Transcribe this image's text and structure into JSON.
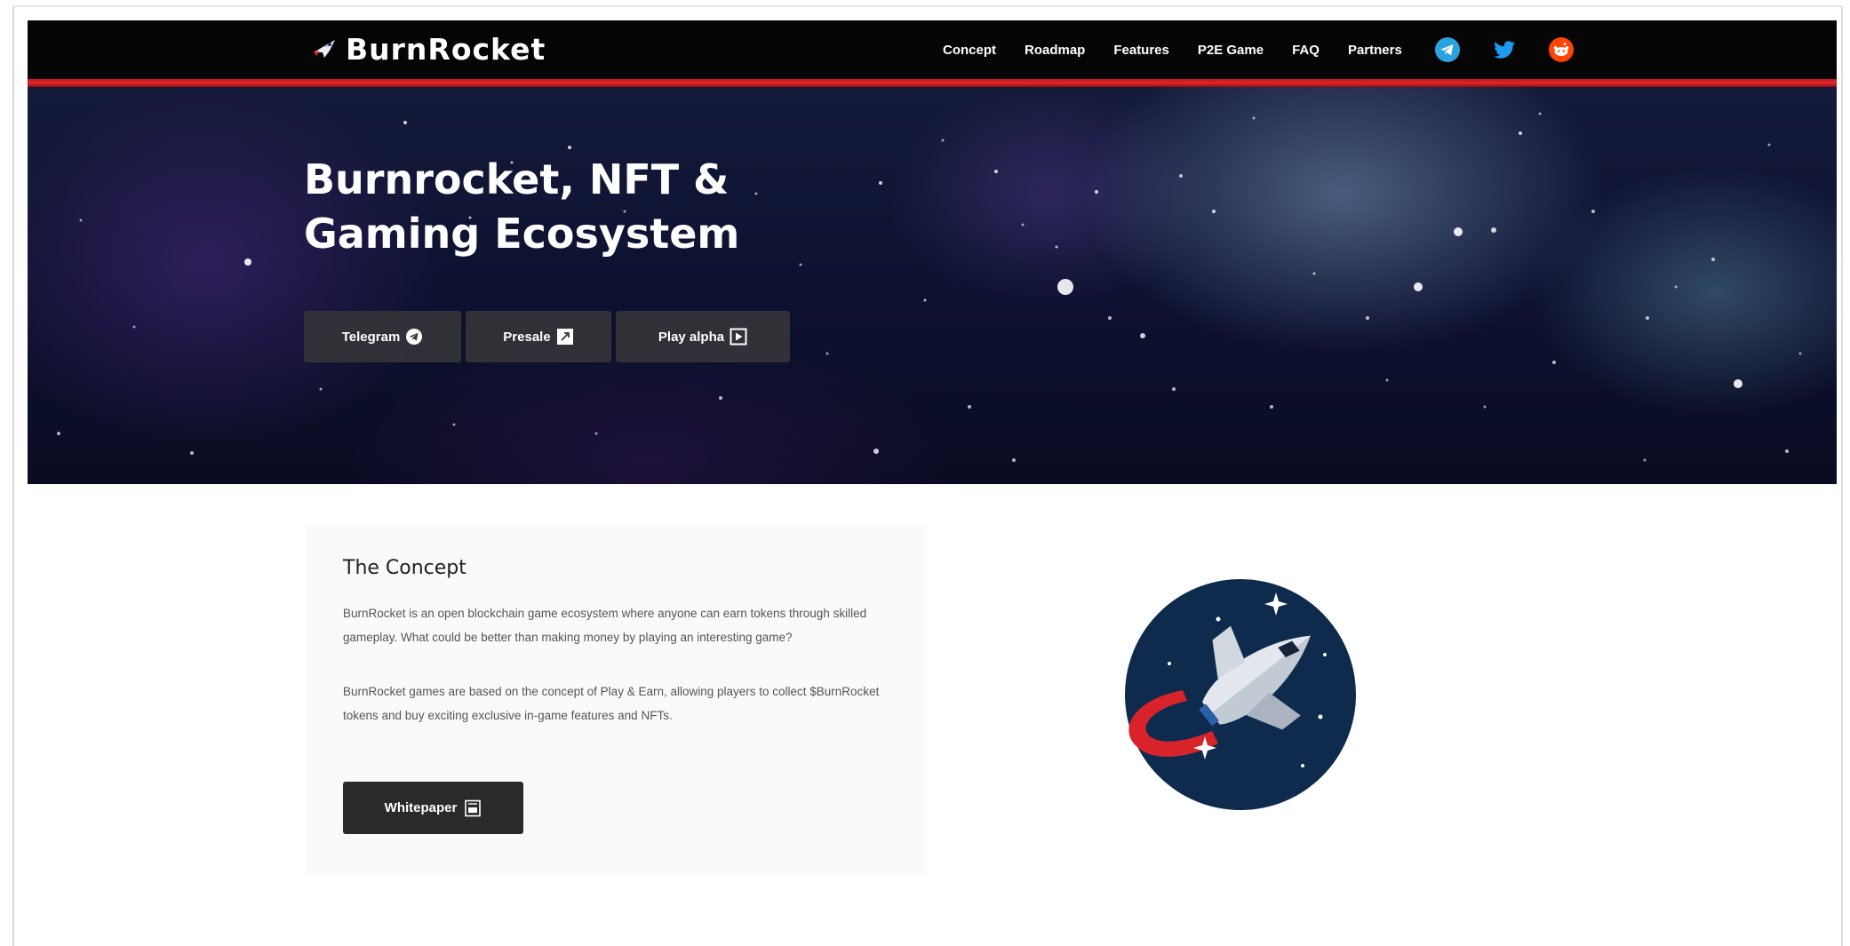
{
  "brand": {
    "name": "BurnRocket"
  },
  "nav": {
    "links": [
      "Concept",
      "Roadmap",
      "Features",
      "P2E Game",
      "FAQ",
      "Partners"
    ],
    "social": [
      "telegram-icon",
      "twitter-icon",
      "reddit-icon"
    ]
  },
  "hero": {
    "title": "Burnrocket, NFT & Gaming Ecosystem",
    "buttons": [
      {
        "label": "Telegram",
        "icon": "telegram-icon"
      },
      {
        "label": "Presale",
        "icon": "external-link-icon"
      },
      {
        "label": "Play alpha",
        "icon": "play-icon"
      }
    ]
  },
  "concept": {
    "title": "The Concept",
    "paragraph1": "BurnRocket is an open blockchain game ecosystem where anyone can earn tokens through skilled gameplay. What could be better than making money by playing an interesting game?",
    "paragraph2": "BurnRocket games are based on the concept of Play & Earn, allowing players to collect $BurnRocket tokens and buy exciting exclusive in-game features and NFTs.",
    "button": {
      "label": "Whitepaper",
      "icon": "document-icon"
    }
  },
  "colors": {
    "navbar": "#050505",
    "accent_red": "#d9232a",
    "telegram": "#2aa3df",
    "twitter": "#1d9bf0",
    "reddit": "#ff4500",
    "rocket_circle": "#0e2b4d"
  }
}
